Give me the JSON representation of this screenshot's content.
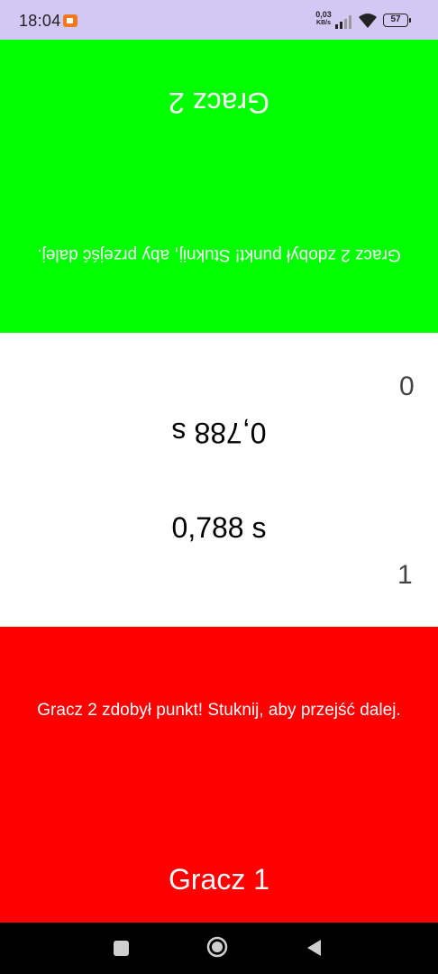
{
  "status_bar": {
    "time": "18:04",
    "net_speed_value": "0,03",
    "net_speed_unit": "KB/s",
    "battery": "57",
    "icons": [
      "screen-record-icon",
      "signal-icon",
      "wifi-icon",
      "battery-icon"
    ]
  },
  "player2": {
    "name": "Gracz 2",
    "message": "Gracz 2 zdobył punkt! Stuknij, aby przejść dalej.",
    "color": "#00ff00",
    "score": "0",
    "time": "0,788 s"
  },
  "player1": {
    "name": "Gracz 1",
    "message": "Gracz 2 zdobył punkt! Stuknij, aby przejść dalej.",
    "color": "#ff0000",
    "score": "1",
    "time": "0,788 s"
  },
  "nav_bar": {
    "icons": [
      "recents-icon",
      "home-icon",
      "back-icon"
    ]
  }
}
